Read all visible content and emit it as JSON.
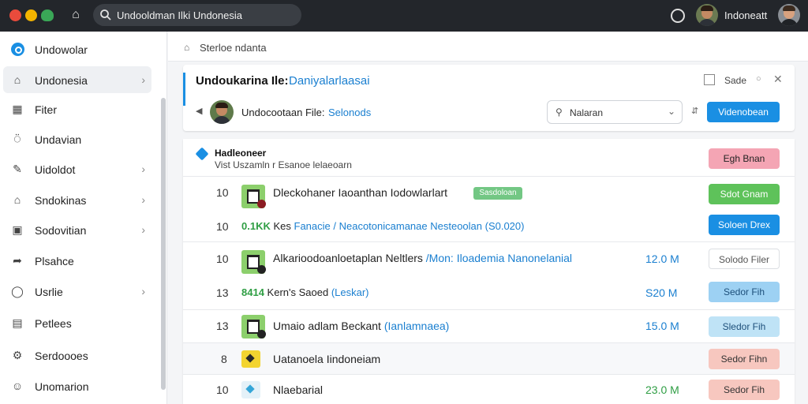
{
  "topbar": {
    "search_text": "Undooldman Ilki Undonesia",
    "user_name": "Indoneatt"
  },
  "sidebar": {
    "items": [
      {
        "label": "Undowolar",
        "icon": "brand-icon"
      },
      {
        "label": "Undonesia",
        "icon": "home-icon"
      },
      {
        "label": "Fiter",
        "icon": "calendar-icon"
      },
      {
        "label": "Undavian",
        "icon": "lock-icon"
      },
      {
        "label": "Uidoldot",
        "icon": "pen-icon"
      },
      {
        "label": "Sndokinas",
        "icon": "home-icon"
      },
      {
        "label": "Sodovitian",
        "icon": "box-icon"
      },
      {
        "label": "Plsahce",
        "icon": "share-icon"
      },
      {
        "label": "Usrlie",
        "icon": "circle-icon"
      },
      {
        "label": "Petlees",
        "icon": "doc-icon"
      },
      {
        "label": "Serdoooes",
        "icon": "gear-icon"
      },
      {
        "label": "Unomarion",
        "icon": "person-icon"
      }
    ]
  },
  "breadcrumb": {
    "text": "Sterloe ndanta"
  },
  "header_card": {
    "title_main": "Undoukarina Ile:",
    "title_accent": "Daniyalarlaasai",
    "right_label": "Sade",
    "subtitle_main": "Undocootaan File:",
    "subtitle_accent": "Selonods",
    "filter_text": "Nalaran",
    "primary_button": "Videnobean"
  },
  "list": {
    "header_title": "Hadleoneer",
    "header_subtitle": "Vist   Uszamln r Esanoe lelaeoarn",
    "header_button": "Egh Bnan",
    "rows": [
      {
        "num": "10",
        "name": "Dleckohaner Iaoanthan Iodowlarlart",
        "tag": "Sasdoloan",
        "sub_num": "10",
        "sub_green": "0.1KK",
        "sub_text": "Kes",
        "sub_blue": "Fanacie / Neacotonicamanae Nesteoolan (S0.020)",
        "btn1": "Sdot Gnam",
        "btn2": "Soloen Drex"
      },
      {
        "num": "10",
        "name": "Alkarioodoanloetaplan Neltlers",
        "name_hl": "/Mon: Iloademia Nanonelanial",
        "size": "12.0 M",
        "btn": "Solodo Filer",
        "sub_num": "13",
        "sub_green": "8414",
        "sub_text": "Kern's Saoed",
        "sub_blue": "(Leskar)",
        "size2": "S20 M",
        "btn2": "Sedor Fih"
      },
      {
        "num": "13",
        "name": "Umaio adlam Beckant",
        "name_hl": "(Ianlamnaea)",
        "size": "15.0 M",
        "btn": "Sledor Fih"
      },
      {
        "num": "8",
        "name": "Uatanoela Iindoneiam",
        "btn": "Sedor Fihn"
      },
      {
        "num": "10",
        "name": "Nlaebarial",
        "size": "23.0 M",
        "btn": "Sedor Fih"
      }
    ]
  }
}
